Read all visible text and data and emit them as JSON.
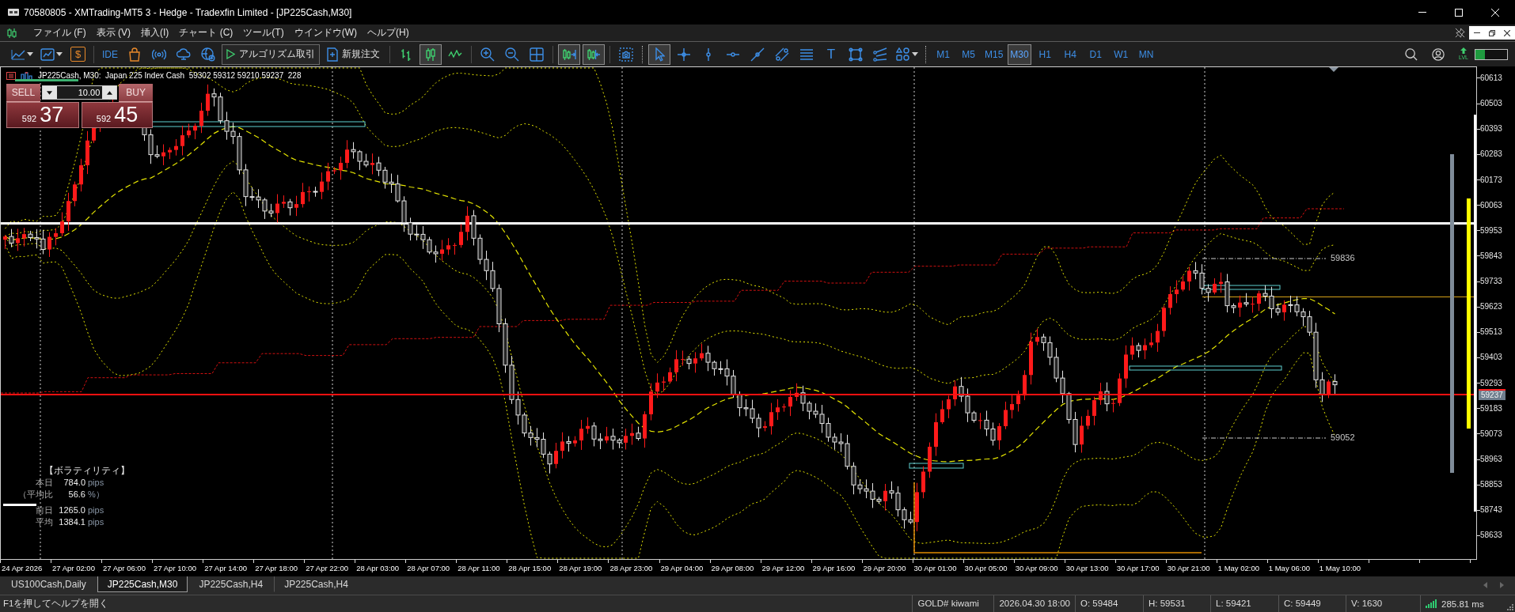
{
  "window": {
    "title": "70580805 - XMTrading-MT5 3 - Hedge - Tradexfin Limited - [JP225Cash,M30]"
  },
  "menu": [
    "ファイル (F)",
    "表示 (V)",
    "挿入(I)",
    "チャート (C)",
    "ツール(T)",
    "ウインドウ(W)",
    "ヘルプ(H)"
  ],
  "toolbar": {
    "dollar_glyph": "$",
    "ide_label": "IDE",
    "algo_trading": {
      "label": "アルゴリズム取引"
    },
    "new_order": {
      "label": "新規注文"
    },
    "chart_types": [
      {
        "kind": "bars",
        "selected": false
      },
      {
        "kind": "candles",
        "selected": true
      },
      {
        "kind": "line",
        "selected": false
      }
    ],
    "auto_scroll": {
      "on": true
    },
    "chart_shift": {
      "on": true
    },
    "tools": [
      {
        "kind": "cursor",
        "selected": true
      },
      {
        "kind": "crosshair",
        "selected": false
      },
      {
        "kind": "vline",
        "selected": false
      },
      {
        "kind": "hline",
        "selected": false
      },
      {
        "kind": "trendline",
        "selected": false
      },
      {
        "kind": "channel",
        "selected": false
      },
      {
        "kind": "fibo",
        "selected": false
      },
      {
        "kind": "text",
        "glyph": "T",
        "selected": false
      },
      {
        "kind": "rectangle",
        "selected": false
      },
      {
        "kind": "pitchfork",
        "selected": false
      },
      {
        "kind": "shapes",
        "selected": false
      }
    ],
    "timeframes": [
      {
        "label": "M1",
        "selected": false
      },
      {
        "label": "M5",
        "selected": false
      },
      {
        "label": "M15",
        "selected": false
      },
      {
        "label": "M30",
        "selected": true
      },
      {
        "label": "H1",
        "selected": false
      },
      {
        "label": "H4",
        "selected": false
      },
      {
        "label": "D1",
        "selected": false
      },
      {
        "label": "W1",
        "selected": false
      },
      {
        "label": "MN",
        "selected": false
      }
    ],
    "level_badge": {
      "label": "LVL"
    },
    "meter": {
      "level": 0.3
    }
  },
  "chart": {
    "info": "JP225Cash, M30:  Japan 225 Index Cash  59302 59312 59210 59237  228",
    "trade_panel": {
      "sell": {
        "label": "SELL",
        "price_head": "592",
        "price_tail": "37"
      },
      "volume": "10.00",
      "buy": {
        "label": "BUY",
        "price_head": "592",
        "price_tail": "45"
      }
    },
    "volatility": {
      "title": "【ボラティリティ】",
      "rows": [
        {
          "label": "本日",
          "value": "784.0",
          "unit": "pips"
        },
        {
          "label": "（平均比",
          "value": "56.6",
          "unit": "%）"
        },
        {
          "label": "前日",
          "value": "1265.0",
          "unit": "pips"
        },
        {
          "label": "平均",
          "value": "1384.1",
          "unit": "pips"
        }
      ]
    },
    "level_labels": [
      "59836",
      "59052"
    ],
    "price_axis": {
      "ticks": [
        "60613",
        "60503",
        "60393",
        "60283",
        "60173",
        "60063",
        "59953",
        "59843",
        "59733",
        "59623",
        "59513",
        "59403",
        "59293",
        "59183",
        "59073",
        "58963",
        "58853",
        "58743",
        "58633"
      ],
      "current": "59237"
    },
    "time_axis": {
      "ticks": [
        "24 Apr 2026",
        "27 Apr 02:00",
        "27 Apr 06:00",
        "27 Apr 10:00",
        "27 Apr 14:00",
        "27 Apr 18:00",
        "27 Apr 22:00",
        "28 Apr 03:00",
        "28 Apr 07:00",
        "28 Apr 11:00",
        "28 Apr 15:00",
        "28 Apr 19:00",
        "28 Apr 23:00",
        "29 Apr 04:00",
        "29 Apr 08:00",
        "29 Apr 12:00",
        "29 Apr 16:00",
        "29 Apr 20:00",
        "30 Apr 01:00",
        "30 Apr 05:00",
        "30 Apr 09:00",
        "30 Apr 13:00",
        "30 Apr 17:00",
        "30 Apr 21:00",
        "1 May 02:00",
        "1 May 06:00",
        "1 May 10:00"
      ]
    }
  },
  "tabs": [
    {
      "label": "US100Cash,Daily",
      "selected": false
    },
    {
      "label": "JP225Cash,M30",
      "selected": true
    },
    {
      "label": "JP225Cash,H4",
      "selected": false
    },
    {
      "label": "JP225Cash,H4",
      "selected": false
    }
  ],
  "status_bar": {
    "help": "F1を押してヘルプを開く",
    "fields": [
      "GOLD# kiwami",
      "2026.04.30 18:00",
      "O: 59484",
      "H: 59531",
      "L: 59421",
      "C: 59449",
      "V: 1630"
    ],
    "ping": "285.81 ms"
  }
}
